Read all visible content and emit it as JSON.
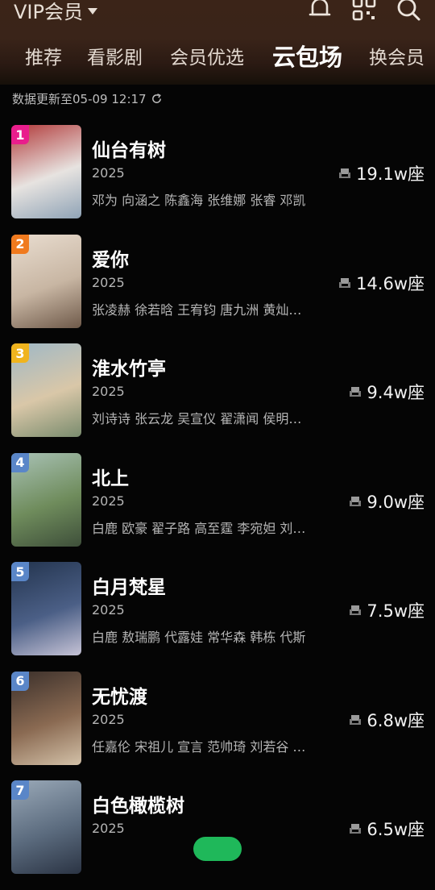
{
  "header": {
    "dropdown_label": "VIP会员",
    "icons": [
      "bell-icon",
      "scan-icon",
      "search-icon"
    ],
    "tabs": [
      {
        "label": "推荐",
        "active": false
      },
      {
        "label": "看影剧",
        "active": false
      },
      {
        "label": "会员优选",
        "active": false
      },
      {
        "label": "云包场",
        "active": true
      },
      {
        "label": "换会员",
        "active": false
      }
    ]
  },
  "update_text": "数据更新至05-09 12:17",
  "ranking": [
    {
      "rank": "1",
      "title": "仙台有树",
      "year": "2025",
      "cast": "邓为 向涵之 陈鑫海 张维娜 张睿 邓凯",
      "seats": "19.1w座",
      "rank_color": "#e91e8c",
      "poster_colors": [
        "#b23a3a",
        "#e7e3e0",
        "#8fa3b6"
      ]
    },
    {
      "rank": "2",
      "title": "爱你",
      "year": "2025",
      "cast": "张凌赫 徐若晗 王宥钧 唐九洲 黄灿…",
      "seats": "14.6w座",
      "rank_color": "#f07a1e",
      "poster_colors": [
        "#e9ddd0",
        "#c8b6a3",
        "#6f5a4a"
      ]
    },
    {
      "rank": "3",
      "title": "淮水竹亭",
      "year": "2025",
      "cast": "刘诗诗 张云龙 吴宣仪 翟潇闻 侯明…",
      "seats": "9.4w座",
      "rank_color": "#f0b41e",
      "poster_colors": [
        "#9fb8c6",
        "#d9c7a8",
        "#7a8c6e"
      ]
    },
    {
      "rank": "4",
      "title": "北上",
      "year": "2025",
      "cast": "白鹿 欧豪 翟子路 高至霆 李宛妲 刘…",
      "seats": "9.0w座",
      "rank_color": "#5a86c8",
      "poster_colors": [
        "#a9c2b6",
        "#6f8c5c",
        "#3e4f3a"
      ]
    },
    {
      "rank": "5",
      "title": "白月梵星",
      "year": "2025",
      "cast": "白鹿 敖瑞鹏 代露娃 常华森 韩栋 代斯",
      "seats": "7.5w座",
      "rank_color": "#5a86c8",
      "poster_colors": [
        "#23344e",
        "#4b5f86",
        "#c6c3d6"
      ]
    },
    {
      "rank": "6",
      "title": "无忧渡",
      "year": "2025",
      "cast": "任嘉伦 宋祖儿 宣言 范帅琦 刘若谷 …",
      "seats": "6.8w座",
      "rank_color": "#5a86c8",
      "poster_colors": [
        "#3a2f2a",
        "#8a6a52",
        "#d3c1a8"
      ]
    },
    {
      "rank": "7",
      "title": "白色橄榄树",
      "year": "2025",
      "cast": "",
      "seats": "6.5w座",
      "rank_color": "#5a86c8",
      "poster_colors": [
        "#9aa9b8",
        "#5b6b7e",
        "#2b3444"
      ]
    }
  ]
}
